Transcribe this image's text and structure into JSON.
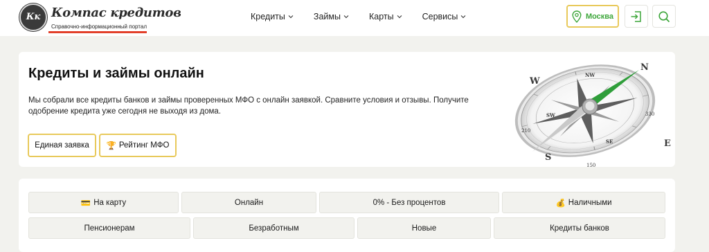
{
  "logo": {
    "monogram": "Кк",
    "title": "Компас кредитов",
    "subtitle": "Справочно-информационный портал"
  },
  "nav": {
    "items": [
      {
        "label": "Кредиты"
      },
      {
        "label": "Займы"
      },
      {
        "label": "Карты"
      },
      {
        "label": "Сервисы"
      }
    ]
  },
  "header": {
    "city": "Москва"
  },
  "hero": {
    "title": "Кредиты и займы онлайн",
    "description": "Мы собрали все кредиты банков и займы проверенных МФО с онлайн заявкой. Сравните условия и отзывы. Получите одобрение кредита уже сегодня не выходя из дома.",
    "btn_application": "Единая заявка",
    "btn_rating": "Рейтинг МФО",
    "btn_rating_emoji": "🏆",
    "compass": {
      "N": "N",
      "E": "E",
      "S": "S",
      "W": "W",
      "NW": "NW",
      "SE": "SE",
      "SW": "SW",
      "t1": "150",
      "t2": "210",
      "t3": "330"
    }
  },
  "categories": {
    "row1": [
      {
        "label": "На карту",
        "emoji": "💳"
      },
      {
        "label": "Онлайн",
        "emoji": ""
      },
      {
        "label": "0% - Без процентов",
        "emoji": ""
      },
      {
        "label": "Наличными",
        "emoji": "💰"
      }
    ],
    "row2": [
      {
        "label": "Пенсионерам"
      },
      {
        "label": "Безработным"
      },
      {
        "label": "Новые"
      },
      {
        "label": "Кредиты банков"
      }
    ]
  },
  "colors": {
    "accent_yellow": "#e8c95a",
    "accent_green": "#3da63a",
    "logo_red": "#e2402a"
  }
}
